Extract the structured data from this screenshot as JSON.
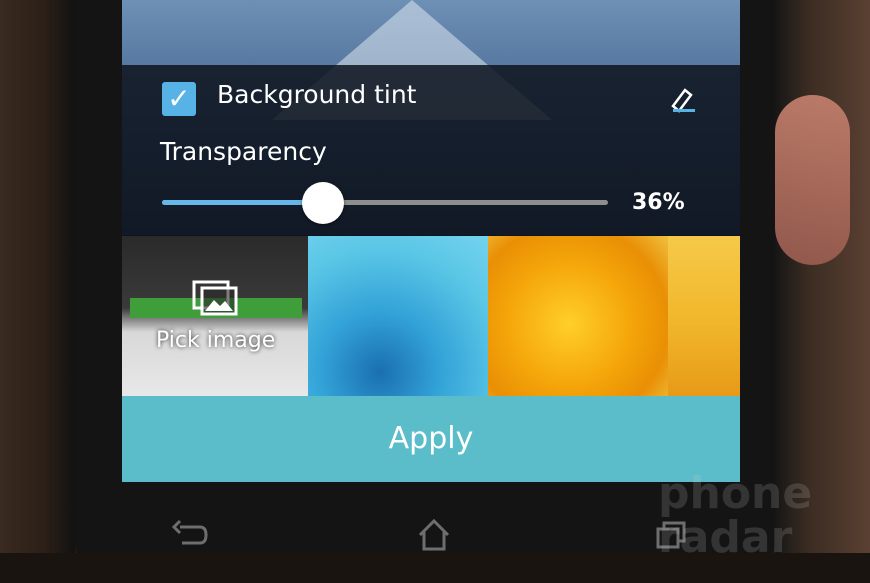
{
  "wallpaper_panel": {
    "background_tint": {
      "label": "Background tint",
      "checked": true
    },
    "transparency": {
      "label": "Transparency",
      "value_percent": 36,
      "display": "36%"
    },
    "accent_color": "#57b3e6"
  },
  "thumbnails": {
    "pick_image": {
      "label": "Pick image"
    },
    "items": [
      "water-splash",
      "orange-rope",
      "sunset"
    ]
  },
  "apply_button": {
    "label": "Apply",
    "color": "#5bbdc9"
  },
  "navigation": {
    "icons": [
      "back-icon",
      "home-icon",
      "recent-apps-icon"
    ]
  },
  "watermark": {
    "lines": [
      "phone",
      "radar"
    ]
  }
}
